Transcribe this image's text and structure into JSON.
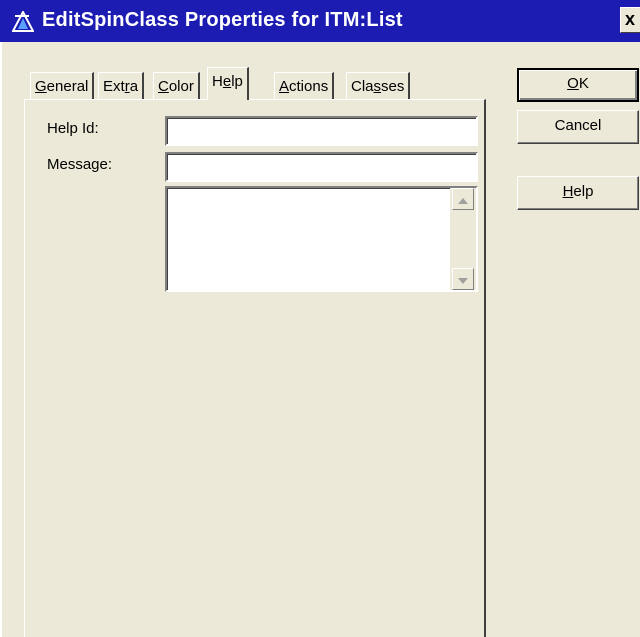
{
  "window": {
    "title": "EditSpinClass Properties for ITM:List",
    "close_glyph": "x",
    "icon": "app-triangle-icon"
  },
  "tabs": [
    {
      "pre": "",
      "ul": "G",
      "post": "eneral"
    },
    {
      "pre": "Ext",
      "ul": "r",
      "post": "a"
    },
    {
      "pre": "",
      "ul": "C",
      "post": "olor"
    },
    {
      "pre": "H",
      "ul": "e",
      "post": "lp"
    },
    {
      "pre": "",
      "ul": "A",
      "post": "ctions"
    },
    {
      "pre": "Cla",
      "ul": "s",
      "post": "ses"
    }
  ],
  "active_tab": "Help",
  "help_panel": {
    "help_id_label": "Help Id:",
    "help_id_value": "",
    "message_label": "Message:",
    "message_value": "",
    "message_text_value": ""
  },
  "buttons": {
    "ok": {
      "ul": "O",
      "post": "K"
    },
    "cancel": "Cancel",
    "help": {
      "ul": "H",
      "post": "elp"
    }
  },
  "colors": {
    "title_bar": "#1c1cb2",
    "dialog_bg": "#ece9d8"
  }
}
